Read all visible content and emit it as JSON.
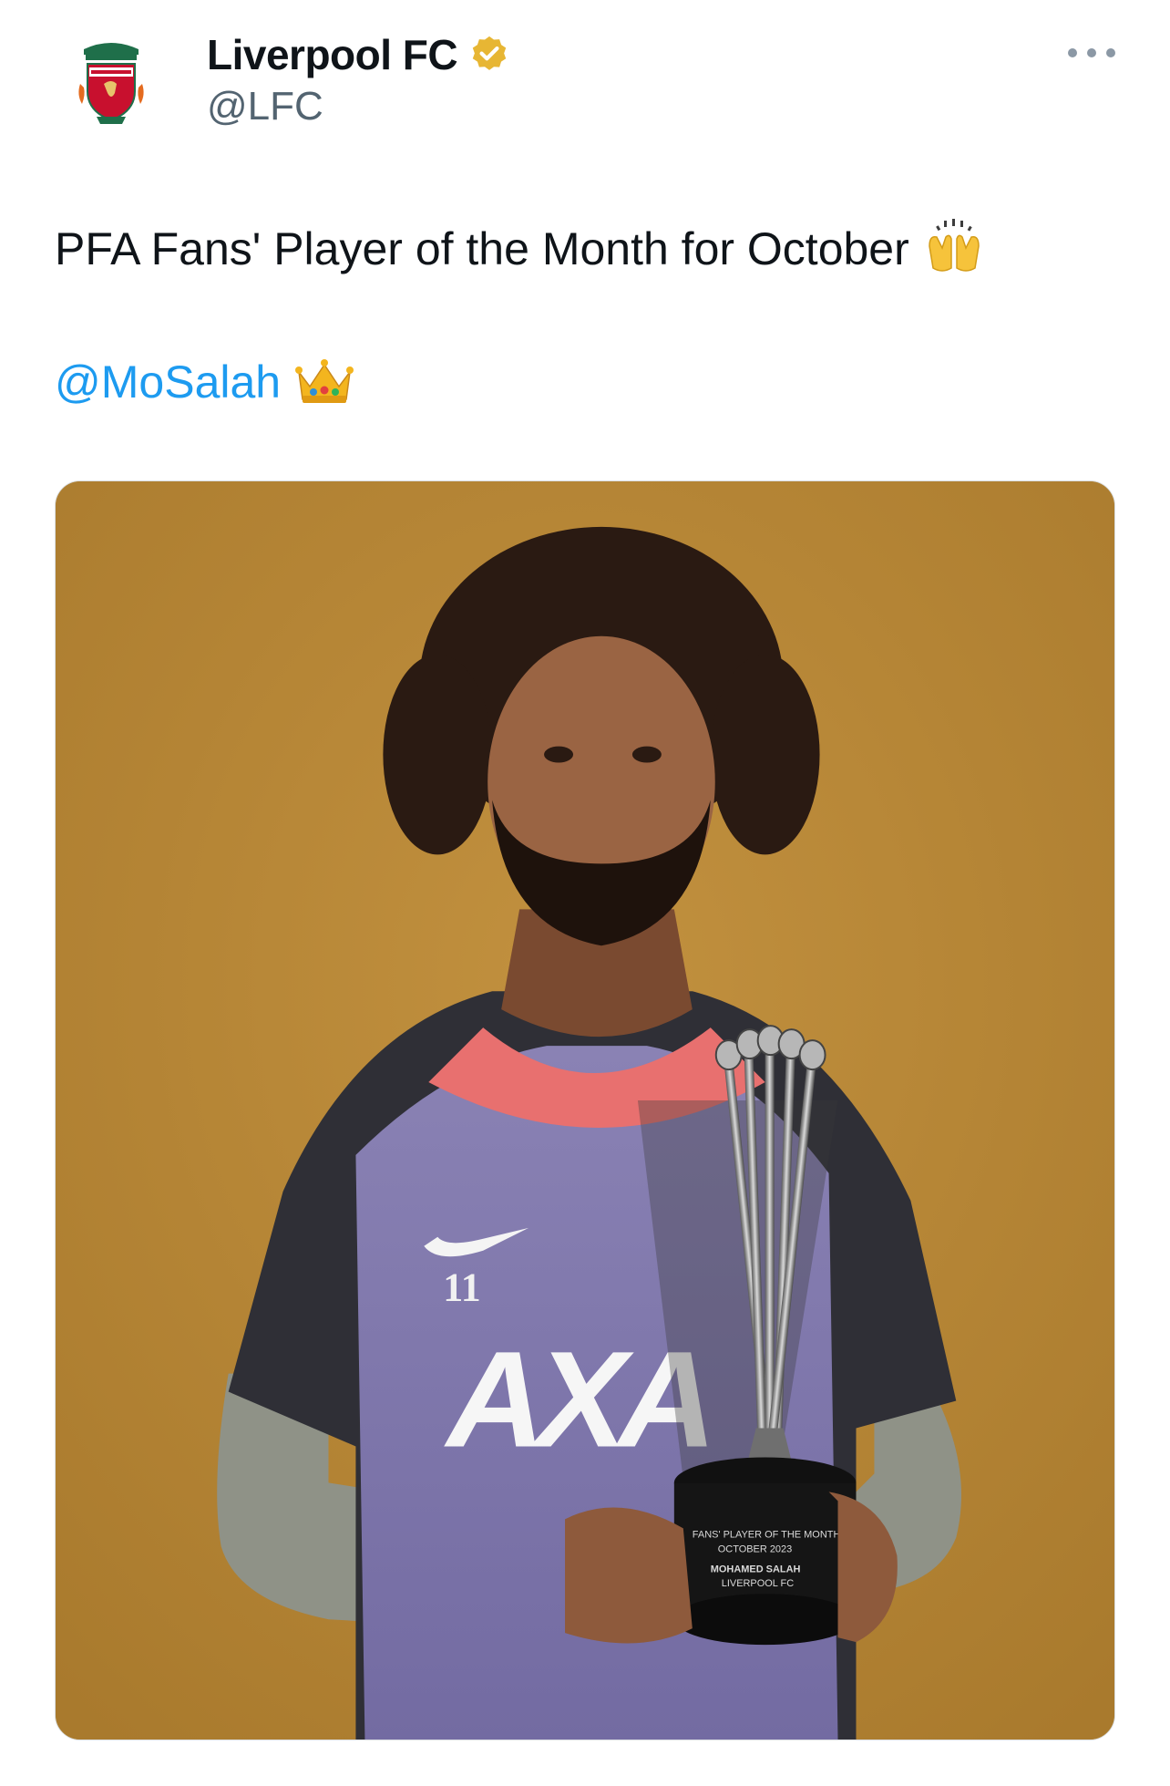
{
  "author": {
    "name": "Liverpool FC",
    "handle": "@LFC",
    "verified_color": "#e7b634"
  },
  "menu": {
    "icon": "more-horizontal-icon"
  },
  "tweet": {
    "text": "PFA Fans' Player of the Month for October",
    "text_emoji": "raising-hands-emoji",
    "mention": "@MoSalah",
    "mention_emoji": "crown-emoji"
  },
  "media": {
    "jersey_number": "11",
    "sponsor": "AXA",
    "trophy_lines": [
      "FANS' PLAYER OF THE MONTH",
      "OCTOBER 2023",
      "MOHAMED SALAH",
      "LIVERPOOL FC"
    ]
  },
  "colors": {
    "link": "#1d9bf0",
    "text": "#0f1419",
    "secondary": "#536471",
    "photo_background": "#b98a3a"
  }
}
